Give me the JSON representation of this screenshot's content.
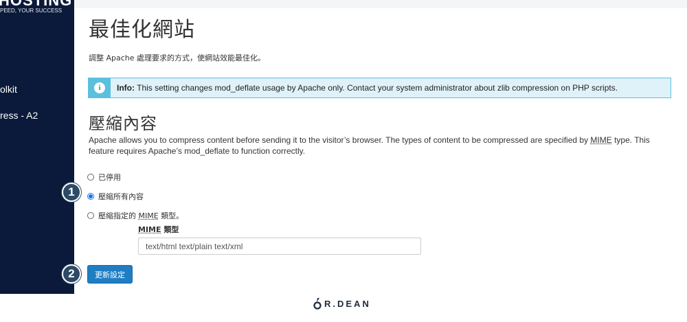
{
  "sidebar": {
    "logo_top": "HOSTING",
    "logo_tagline": "PEED, YOUR SUCCESS",
    "items": [
      {
        "label": "olkit"
      },
      {
        "label": "ress - A2"
      }
    ]
  },
  "page": {
    "title": "最佳化網站",
    "description": "調整 Apache 處理要求的方式，使網站效能最佳化。"
  },
  "info": {
    "icon": "info-icon",
    "label": "Info:",
    "text": " This setting changes mod_deflate usage by Apache only. Contact your system administrator about zlib compression on PHP scripts."
  },
  "section": {
    "title": "壓縮內容",
    "desc_part1": "Apache allows you to compress content before sending it to the visitor’s browser. The types of content to be compressed are specified by ",
    "desc_mime": "MIME",
    "desc_part2": " type. This feature requires Apache’s mod_deflate to function correctly."
  },
  "options": [
    {
      "label": "已停用",
      "selected": false
    },
    {
      "label": "壓縮所有內容",
      "selected": true
    },
    {
      "label_prefix": "壓縮指定的 ",
      "label_mime": "MIME",
      "label_suffix": " 類型。",
      "selected": false
    }
  ],
  "mime": {
    "label_mime": "MIME",
    "label_suffix": " 類型",
    "value": "text/html text/plain text/xml"
  },
  "button": {
    "label": "更新設定"
  },
  "steps": [
    "1",
    "2"
  ],
  "footer": {
    "text": "R.DEAN"
  },
  "colors": {
    "sidebar_bg": "#0b1a3a",
    "info_accent": "#5bc0de",
    "button_bg": "#1f7dc4",
    "step_bg": "#2c4a66"
  }
}
